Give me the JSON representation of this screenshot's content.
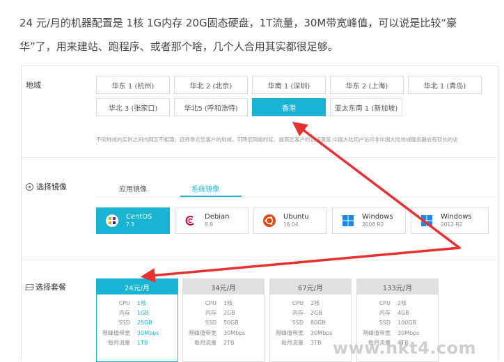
{
  "article": {
    "line1": "24 元/月的机器配置是 1核 1G内存 20G固态硬盘，1T流量，30M带宽峰值，可以说是比较“豪",
    "line2": "华”了，用来建站、跑程序、或者那个啥，几个人合用其实都很足够。"
  },
  "region": {
    "label": "地域",
    "items": [
      "华东 1 (杭州)",
      "华北 2 (北京)",
      "华南 1 (深圳)",
      "华东 2 (上海)",
      "华北 1 (青岛)",
      "华北 3 (张家口)",
      "华北5 (呼和浩特)",
      "香港",
      "亚太东南 1 (新加坡)"
    ],
    "selected": "香港",
    "note": "不同地域的实例之间内网互不相通；选择靠近您客户的地域，可降低网络时延、提高您客户的访问速度,中国大陆用户访问非中国大陆地域服务器会有较长的访"
  },
  "image": {
    "label": "选择镜像",
    "tabs": [
      "应用镜像",
      "系统镜像"
    ],
    "active_tab": "系统镜像",
    "os": [
      {
        "name": "CentOS",
        "version": "7.3",
        "icon": "centos-icon"
      },
      {
        "name": "Debian",
        "version": "8.9",
        "icon": "debian-icon"
      },
      {
        "name": "Ubuntu",
        "version": "16.04",
        "icon": "ubuntu-icon"
      },
      {
        "name": "Windows",
        "version": "2008 R2",
        "icon": "windows-icon"
      },
      {
        "name": "Windows",
        "version": "2012 R2",
        "icon": "windows-icon"
      }
    ],
    "selected_os": "CentOS"
  },
  "package": {
    "label": "选择套餐",
    "row_labels": [
      "CPU",
      "内存",
      "SSD",
      "限峰值带宽",
      "每月流量"
    ],
    "plans": [
      {
        "price": "24元/月",
        "values": [
          "1核",
          "1GB",
          "25GB",
          "30Mbps",
          "1TB"
        ]
      },
      {
        "price": "34元/月",
        "values": [
          "1核",
          "2GB",
          "50GB",
          "30Mbps",
          "2TB"
        ]
      },
      {
        "price": "67元/月",
        "values": [
          "2核",
          "2GB",
          "80GB",
          "30Mbps",
          "3TB"
        ]
      },
      {
        "price": "133元/月",
        "values": [
          "2核",
          "4GB",
          "100GB",
          "30Mbps",
          "4TB"
        ]
      }
    ],
    "selected_plan": "24元/月"
  },
  "watermark": "www.hkt4.com",
  "colors": {
    "accent": "#19b4d4",
    "arrow": "#e8302e"
  }
}
